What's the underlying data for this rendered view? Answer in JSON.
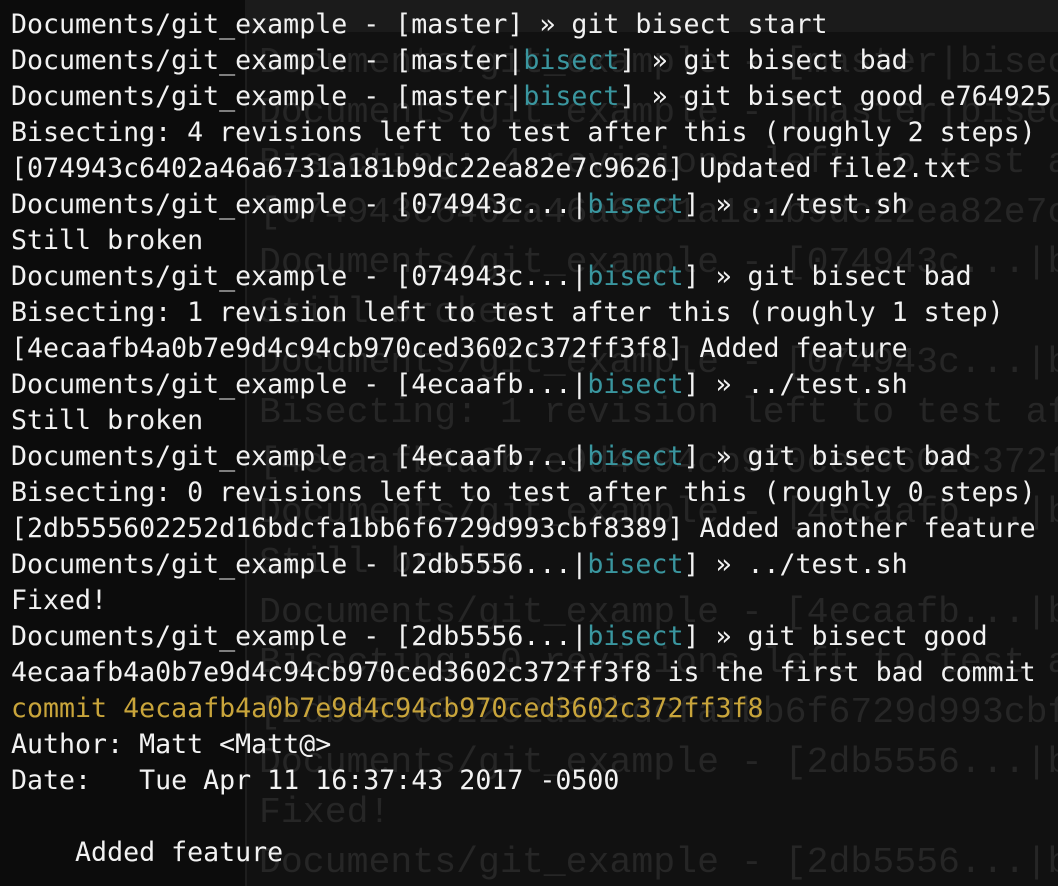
{
  "terminal": {
    "colors": {
      "text": "#f2f2f2",
      "branch_state": "#3a969f",
      "commit_header": "#c9a53b",
      "background": "#0c0c0c"
    },
    "lines": [
      [
        {
          "t": "Documents/git_example - [master] » git bisect start"
        }
      ],
      [
        {
          "t": "Documents/git_example - [master|"
        },
        {
          "t": "bisect",
          "c": "teal"
        },
        {
          "t": "] » git bisect bad"
        }
      ],
      [
        {
          "t": "Documents/git_example - [master|"
        },
        {
          "t": "bisect",
          "c": "teal"
        },
        {
          "t": "] » git bisect good e764925"
        }
      ],
      [
        {
          "t": "Bisecting: 4 revisions left to test after this (roughly 2 steps)"
        }
      ],
      [
        {
          "t": "[074943c6402a46a6731a181b9dc22ea82e7c9626] Updated file2.txt"
        }
      ],
      [
        {
          "t": "Documents/git_example - [074943c...|"
        },
        {
          "t": "bisect",
          "c": "teal"
        },
        {
          "t": "] » ../test.sh"
        }
      ],
      [
        {
          "t": "Still broken"
        }
      ],
      [
        {
          "t": "Documents/git_example - [074943c...|"
        },
        {
          "t": "bisect",
          "c": "teal"
        },
        {
          "t": "] » git bisect bad"
        }
      ],
      [
        {
          "t": "Bisecting: 1 revision left to test after this (roughly 1 step)"
        }
      ],
      [
        {
          "t": "[4ecaafb4a0b7e9d4c94cb970ced3602c372ff3f8] Added feature"
        }
      ],
      [
        {
          "t": "Documents/git_example - [4ecaafb...|"
        },
        {
          "t": "bisect",
          "c": "teal"
        },
        {
          "t": "] » ../test.sh"
        }
      ],
      [
        {
          "t": "Still broken"
        }
      ],
      [
        {
          "t": "Documents/git_example - [4ecaafb...|"
        },
        {
          "t": "bisect",
          "c": "teal"
        },
        {
          "t": "] » git bisect bad"
        }
      ],
      [
        {
          "t": "Bisecting: 0 revisions left to test after this (roughly 0 steps)"
        }
      ],
      [
        {
          "t": "[2db555602252d16bdcfa1bb6f6729d993cbf8389] Added another feature"
        }
      ],
      [
        {
          "t": "Documents/git_example - [2db5556...|"
        },
        {
          "t": "bisect",
          "c": "teal"
        },
        {
          "t": "] » ../test.sh"
        }
      ],
      [
        {
          "t": "Fixed!"
        }
      ],
      [
        {
          "t": "Documents/git_example - [2db5556...|"
        },
        {
          "t": "bisect",
          "c": "teal"
        },
        {
          "t": "] » git bisect good"
        }
      ],
      [
        {
          "t": "4ecaafb4a0b7e9d4c94cb970ced3602c372ff3f8 is the first bad commit"
        }
      ],
      [
        {
          "t": "commit 4ecaafb4a0b7e9d4c94cb970ced3602c372ff3f8",
          "c": "gold"
        }
      ],
      [
        {
          "t": "Author: Matt <Matt@>"
        }
      ],
      [
        {
          "t": "Date:   Tue Apr 11 16:37:43 2017 -0500"
        }
      ],
      [
        {
          "t": ""
        }
      ],
      [
        {
          "t": "    Added feature"
        }
      ]
    ]
  }
}
